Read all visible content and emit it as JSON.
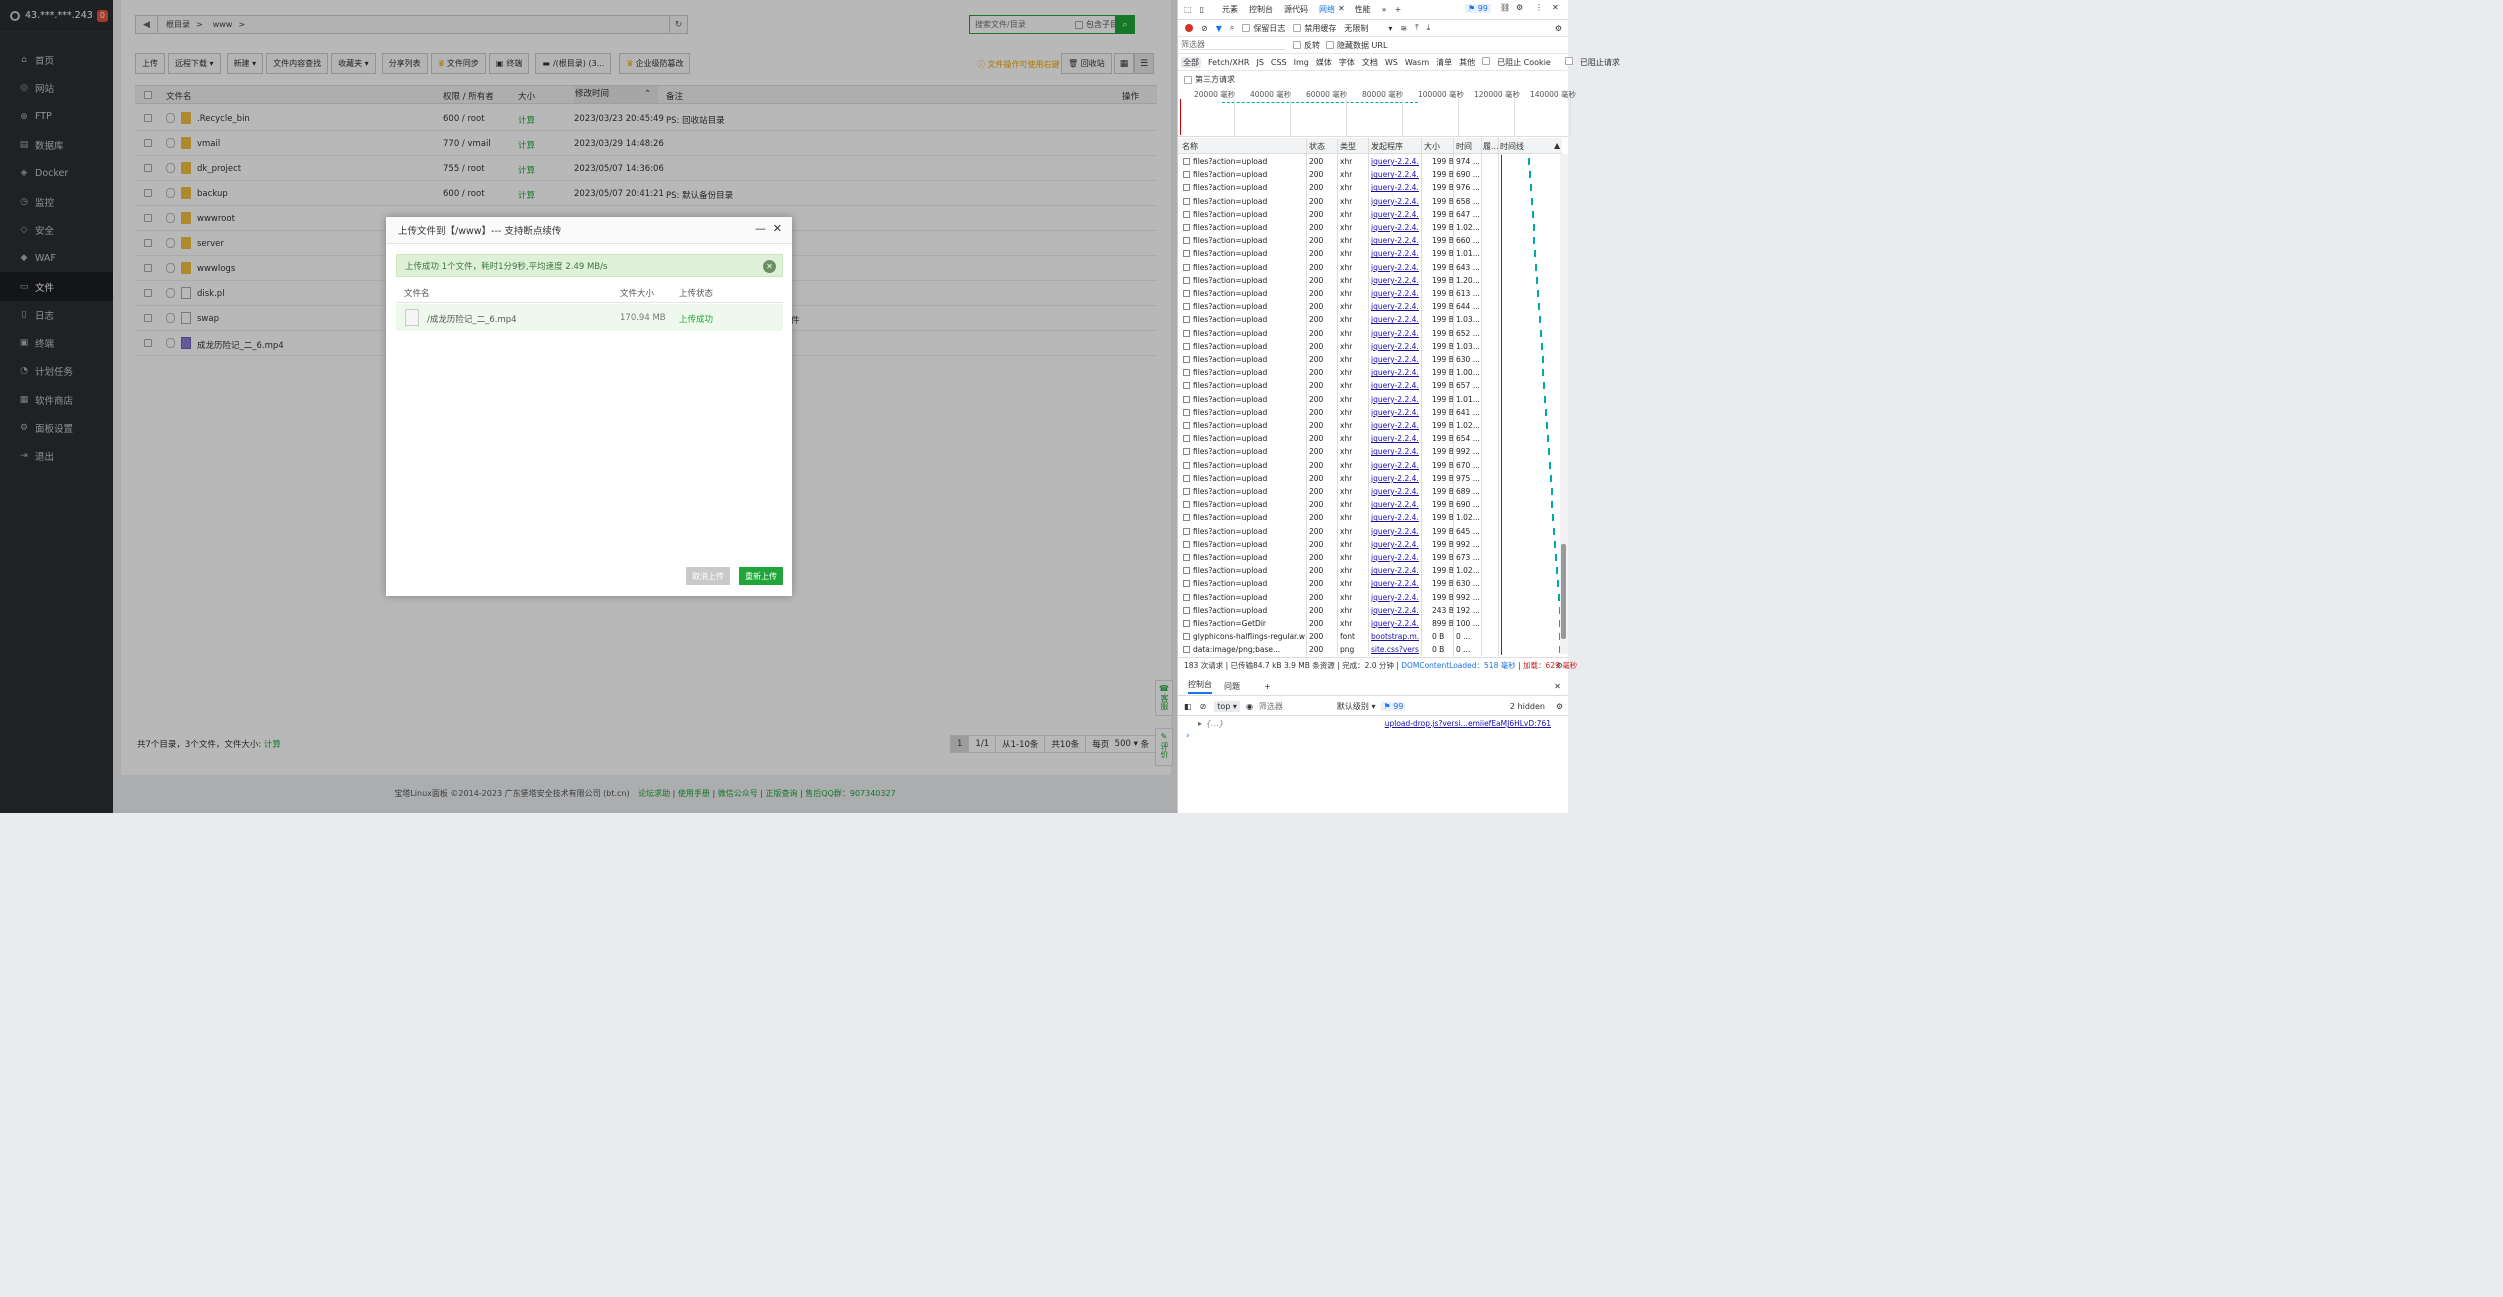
{
  "sidebar": {
    "server": "43.***.***.243",
    "badge": "0",
    "items": [
      {
        "label": "首页",
        "icon": "home-icon",
        "glyph": "⌂"
      },
      {
        "label": "网站",
        "icon": "globe-icon",
        "glyph": "◎"
      },
      {
        "label": "FTP",
        "icon": "ftp-icon",
        "glyph": "⊕"
      },
      {
        "label": "数据库",
        "icon": "database-icon",
        "glyph": "▤"
      },
      {
        "label": "Docker",
        "icon": "docker-icon",
        "glyph": "◈"
      },
      {
        "label": "监控",
        "icon": "monitor-icon",
        "glyph": "◷"
      },
      {
        "label": "安全",
        "icon": "shield-icon",
        "glyph": "◇"
      },
      {
        "label": "WAF",
        "icon": "waf-icon",
        "glyph": "◆"
      },
      {
        "label": "文件",
        "icon": "folder-icon",
        "glyph": "▭",
        "active": true
      },
      {
        "label": "日志",
        "icon": "log-icon",
        "glyph": "▯"
      },
      {
        "label": "终端",
        "icon": "terminal-icon",
        "glyph": "▣"
      },
      {
        "label": "计划任务",
        "icon": "clock-icon",
        "glyph": "◔"
      },
      {
        "label": "软件商店",
        "icon": "grid-icon",
        "glyph": "▦"
      },
      {
        "label": "面板设置",
        "icon": "gear-icon",
        "glyph": "⚙"
      },
      {
        "label": "退出",
        "icon": "logout-icon",
        "glyph": "⇥"
      }
    ]
  },
  "files": {
    "path": [
      "根目录",
      ">",
      "www",
      ">"
    ],
    "search_placeholder": "搜索文件/目录",
    "search_subdir": "包含子目录",
    "toolbar": [
      "上传",
      "远程下载 ▾",
      "新建 ▾",
      "文件内容查找",
      "收藏夹 ▾",
      "分享列表",
      "文件同步",
      "终端",
      "/(根目录) (3...",
      "企业级防篡改"
    ],
    "tip": "文件操作可使用右键",
    "recycle": "回收站",
    "columns": [
      "文件名",
      "权限 / 所有者",
      "大小",
      "修改时间",
      "备注",
      "操作"
    ],
    "rows": [
      {
        "name": ".Recycle_bin",
        "perm": "600 / root",
        "size": "计算",
        "time": "2023/03/23 20:45:49",
        "note": "PS: 回收站目录",
        "type": "folder"
      },
      {
        "name": "vmail",
        "perm": "770 / vmail",
        "size": "计算",
        "time": "2023/03/29 14:48:26",
        "note": "",
        "type": "folder"
      },
      {
        "name": "dk_project",
        "perm": "755 / root",
        "size": "计算",
        "time": "2023/05/07 14:36:06",
        "note": "",
        "type": "folder"
      },
      {
        "name": "backup",
        "perm": "600 / root",
        "size": "计算",
        "time": "2023/05/07 20:41:21",
        "note": "PS: 默认备份目录",
        "type": "folder"
      },
      {
        "name": "wwwroot",
        "perm": "",
        "size": "",
        "time": "",
        "note": "",
        "type": "folder"
      },
      {
        "name": "server",
        "perm": "",
        "size": "",
        "time": "",
        "note": "",
        "type": "folder"
      },
      {
        "name": "wwwlogs",
        "perm": "",
        "size": "",
        "time": "",
        "note": "",
        "type": "folder"
      },
      {
        "name": "disk.pl",
        "perm": "",
        "size": "",
        "time": "",
        "note": "",
        "type": "file"
      },
      {
        "name": "swap",
        "perm": "",
        "size": "",
        "time": "",
        "note": "件",
        "type": "file"
      },
      {
        "name": "成龙历险记_二_6.mp4",
        "perm": "",
        "size": "",
        "time": "",
        "note": "",
        "type": "video"
      }
    ],
    "summary": "共7个目录，3个文件，文件大小:",
    "summary_link": "计算",
    "pager": [
      "1",
      "1/1",
      "从1-10条",
      "共10条",
      "每页",
      "500",
      "▾",
      "条"
    ]
  },
  "sidetabs": [
    "客服",
    "评价"
  ],
  "footer": {
    "copy": "宝塔Linux面板 ©2014-2023 广东堡塔安全技术有限公司 (bt.cn)",
    "links": [
      "论坛求助",
      "使用手册",
      "微信公众号",
      "正版查询",
      "售后QQ群：907340327"
    ]
  },
  "modal": {
    "title": "上传文件到【/www】--- 支持断点续传",
    "alert": "上传成功 1个文件，耗时1分9秒,平均速度 2.49 MB/s",
    "cols": [
      "文件名",
      "文件大小",
      "上传状态"
    ],
    "file": {
      "name": "/成龙历险记_二_6.mp4",
      "size": "170.94 MB",
      "status": "上传成功"
    },
    "cancel": "取消上传",
    "reupload": "重新上传"
  },
  "devtools": {
    "tabs": [
      "元素",
      "控制台",
      "源代码",
      "网络",
      "性能"
    ],
    "active_tab": "网络",
    "issues": "99",
    "preserve_log": "保留日志",
    "disable_cache": "禁用缓存",
    "throttle": "无限制",
    "filter_placeholder": "筛选器",
    "invert": "反转",
    "hide_data": "隐藏数据 URL",
    "types": [
      "全部",
      "Fetch/XHR",
      "JS",
      "CSS",
      "Img",
      "媒体",
      "字体",
      "文档",
      "WS",
      "Wasm",
      "清单",
      "其他"
    ],
    "blocked_cookie": "已阻止 Cookie",
    "blocked_req": "已阻止请求",
    "third_party": "第三方请求",
    "ticks": [
      "20000 毫秒",
      "40000 毫秒",
      "60000 毫秒",
      "80000 毫秒",
      "100000 毫秒",
      "120000 毫秒",
      "140000 毫秒"
    ],
    "columns": [
      "名称",
      "状态",
      "类型",
      "发起程序",
      "大小",
      "时间",
      "履...",
      "时间线"
    ],
    "requests": [
      {
        "name": "files?action=upload",
        "status": "200",
        "type": "xhr",
        "init": "jquery-2.2.4...",
        "size": "199 B",
        "time": "974 ..."
      },
      {
        "name": "files?action=upload",
        "status": "200",
        "type": "xhr",
        "init": "jquery-2.2.4...",
        "size": "199 B",
        "time": "690 ..."
      },
      {
        "name": "files?action=upload",
        "status": "200",
        "type": "xhr",
        "init": "jquery-2.2.4...",
        "size": "199 B",
        "time": "976 ..."
      },
      {
        "name": "files?action=upload",
        "status": "200",
        "type": "xhr",
        "init": "jquery-2.2.4...",
        "size": "199 B",
        "time": "658 ..."
      },
      {
        "name": "files?action=upload",
        "status": "200",
        "type": "xhr",
        "init": "jquery-2.2.4...",
        "size": "199 B",
        "time": "647 ..."
      },
      {
        "name": "files?action=upload",
        "status": "200",
        "type": "xhr",
        "init": "jquery-2.2.4...",
        "size": "199 B",
        "time": "1.02..."
      },
      {
        "name": "files?action=upload",
        "status": "200",
        "type": "xhr",
        "init": "jquery-2.2.4...",
        "size": "199 B",
        "time": "660 ..."
      },
      {
        "name": "files?action=upload",
        "status": "200",
        "type": "xhr",
        "init": "jquery-2.2.4...",
        "size": "199 B",
        "time": "1.01..."
      },
      {
        "name": "files?action=upload",
        "status": "200",
        "type": "xhr",
        "init": "jquery-2.2.4...",
        "size": "199 B",
        "time": "643 ..."
      },
      {
        "name": "files?action=upload",
        "status": "200",
        "type": "xhr",
        "init": "jquery-2.2.4...",
        "size": "199 B",
        "time": "1.20..."
      },
      {
        "name": "files?action=upload",
        "status": "200",
        "type": "xhr",
        "init": "jquery-2.2.4...",
        "size": "199 B",
        "time": "613 ..."
      },
      {
        "name": "files?action=upload",
        "status": "200",
        "type": "xhr",
        "init": "jquery-2.2.4...",
        "size": "199 B",
        "time": "644 ..."
      },
      {
        "name": "files?action=upload",
        "status": "200",
        "type": "xhr",
        "init": "jquery-2.2.4...",
        "size": "199 B",
        "time": "1.03..."
      },
      {
        "name": "files?action=upload",
        "status": "200",
        "type": "xhr",
        "init": "jquery-2.2.4...",
        "size": "199 B",
        "time": "652 ..."
      },
      {
        "name": "files?action=upload",
        "status": "200",
        "type": "xhr",
        "init": "jquery-2.2.4...",
        "size": "199 B",
        "time": "1.03..."
      },
      {
        "name": "files?action=upload",
        "status": "200",
        "type": "xhr",
        "init": "jquery-2.2.4...",
        "size": "199 B",
        "time": "630 ..."
      },
      {
        "name": "files?action=upload",
        "status": "200",
        "type": "xhr",
        "init": "jquery-2.2.4...",
        "size": "199 B",
        "time": "1.00..."
      },
      {
        "name": "files?action=upload",
        "status": "200",
        "type": "xhr",
        "init": "jquery-2.2.4...",
        "size": "199 B",
        "time": "657 ..."
      },
      {
        "name": "files?action=upload",
        "status": "200",
        "type": "xhr",
        "init": "jquery-2.2.4...",
        "size": "199 B",
        "time": "1.01..."
      },
      {
        "name": "files?action=upload",
        "status": "200",
        "type": "xhr",
        "init": "jquery-2.2.4...",
        "size": "199 B",
        "time": "641 ..."
      },
      {
        "name": "files?action=upload",
        "status": "200",
        "type": "xhr",
        "init": "jquery-2.2.4...",
        "size": "199 B",
        "time": "1.02..."
      },
      {
        "name": "files?action=upload",
        "status": "200",
        "type": "xhr",
        "init": "jquery-2.2.4...",
        "size": "199 B",
        "time": "654 ..."
      },
      {
        "name": "files?action=upload",
        "status": "200",
        "type": "xhr",
        "init": "jquery-2.2.4...",
        "size": "199 B",
        "time": "992 ..."
      },
      {
        "name": "files?action=upload",
        "status": "200",
        "type": "xhr",
        "init": "jquery-2.2.4...",
        "size": "199 B",
        "time": "670 ..."
      },
      {
        "name": "files?action=upload",
        "status": "200",
        "type": "xhr",
        "init": "jquery-2.2.4...",
        "size": "199 B",
        "time": "975 ..."
      },
      {
        "name": "files?action=upload",
        "status": "200",
        "type": "xhr",
        "init": "jquery-2.2.4...",
        "size": "199 B",
        "time": "689 ..."
      },
      {
        "name": "files?action=upload",
        "status": "200",
        "type": "xhr",
        "init": "jquery-2.2.4...",
        "size": "199 B",
        "time": "690 ..."
      },
      {
        "name": "files?action=upload",
        "status": "200",
        "type": "xhr",
        "init": "jquery-2.2.4...",
        "size": "199 B",
        "time": "1.02..."
      },
      {
        "name": "files?action=upload",
        "status": "200",
        "type": "xhr",
        "init": "jquery-2.2.4...",
        "size": "199 B",
        "time": "645 ..."
      },
      {
        "name": "files?action=upload",
        "status": "200",
        "type": "xhr",
        "init": "jquery-2.2.4...",
        "size": "199 B",
        "time": "992 ..."
      },
      {
        "name": "files?action=upload",
        "status": "200",
        "type": "xhr",
        "init": "jquery-2.2.4...",
        "size": "199 B",
        "time": "673 ..."
      },
      {
        "name": "files?action=upload",
        "status": "200",
        "type": "xhr",
        "init": "jquery-2.2.4...",
        "size": "199 B",
        "time": "1.02..."
      },
      {
        "name": "files?action=upload",
        "status": "200",
        "type": "xhr",
        "init": "jquery-2.2.4...",
        "size": "199 B",
        "time": "630 ..."
      },
      {
        "name": "files?action=upload",
        "status": "200",
        "type": "xhr",
        "init": "jquery-2.2.4...",
        "size": "199 B",
        "time": "992 ..."
      },
      {
        "name": "files?action=upload",
        "status": "200",
        "type": "xhr",
        "init": "jquery-2.2.4...",
        "size": "243 B",
        "time": "192 ..."
      },
      {
        "name": "files?action=GetDir",
        "status": "200",
        "type": "xhr",
        "init": "jquery-2.2.4...",
        "size": "899 B",
        "time": "100 ..."
      },
      {
        "name": "glyphicons-halflings-regular.w...",
        "status": "200",
        "type": "font",
        "init": "bootstrap.m...",
        "size": "0 B",
        "time": "0 ..."
      },
      {
        "name": "data:image/png;base...",
        "status": "200",
        "type": "png",
        "init": "site.css?versi...",
        "size": "0 B",
        "time": "0 ..."
      }
    ],
    "status_bar": {
      "count": "183 次请求",
      "transferred": "已传输84.7 kB",
      "resources": "3.9 MB 条资源",
      "finish": "完成：2.0 分钟",
      "dcl": "DOMContentLoaded：518 毫秒",
      "load": "加载：629 毫秒"
    },
    "console_tabs": [
      "控制台",
      "问题"
    ],
    "console_context": "top",
    "console_filter": "筛选器",
    "console_level": "默认级别",
    "console_issues": "99",
    "console_hidden": "2 hidden",
    "console_entry": "{…}",
    "console_source": "upload-drop.js?versi…emiiefEaMJ6HLvD:761"
  }
}
